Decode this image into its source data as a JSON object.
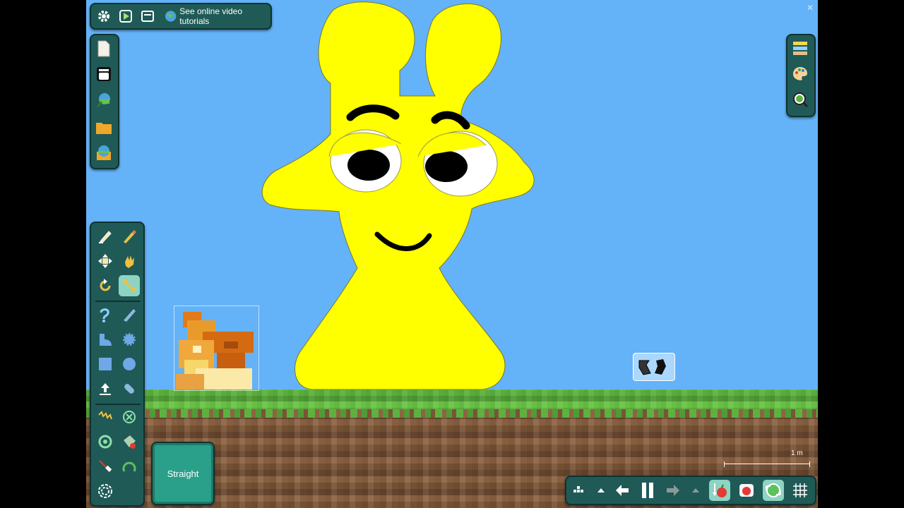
{
  "top_bar": {
    "tutorials_label": "See online video tutorials",
    "icons": [
      "gear-icon",
      "play-icon",
      "window-icon",
      "globe-icon"
    ]
  },
  "file_panel": {
    "icons": [
      "new-document-icon",
      "inventory-icon",
      "open-scene-icon",
      "folder-icon",
      "save-icon"
    ]
  },
  "visual_panel": {
    "icons": [
      "layers-icon",
      "palette-icon",
      "zoom-icon"
    ]
  },
  "tools_panel": {
    "selected": "scale-icon",
    "icons": [
      "sketch-icon",
      "pencil-icon",
      "move-icon",
      "drag-icon",
      "rotate-icon",
      "scale-icon",
      "rope-icon",
      "knife-icon",
      "polygon-icon",
      "gear-shape-icon",
      "box-icon",
      "circle-icon",
      "thruster-icon",
      "capsule-icon",
      "spring-icon",
      "fixate-icon",
      "hinge-icon",
      "tracer-icon",
      "laser-icon",
      "arc-icon",
      "spiral-icon"
    ]
  },
  "tool_option": {
    "label": "Straight"
  },
  "scale": {
    "label": "1 m"
  },
  "sim_panel": {
    "icons": [
      "grid-dots-icon",
      "caret-up-icon",
      "undo-icon",
      "pause-icon",
      "redo-icon",
      "caret-up-icon",
      "gravity-icon",
      "air-friction-icon",
      "follow-camera-icon",
      "grid-icon"
    ]
  },
  "colors": {
    "sky": "#64b2f8",
    "panel": "#1f5a57",
    "character": "#ffff00",
    "selected": "#8fd3c2"
  }
}
